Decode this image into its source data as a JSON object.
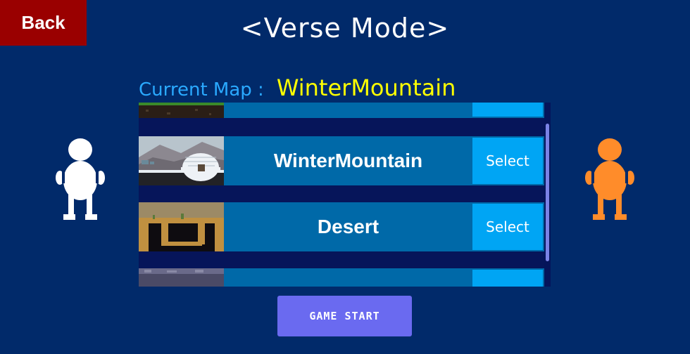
{
  "header": {
    "back_label": "Back",
    "title": "<Verse Mode>"
  },
  "current_map": {
    "label": "Current Map :",
    "value": "WinterMountain"
  },
  "map_list": {
    "items": [
      {
        "name": "",
        "select_label": "",
        "thumb": "grass-level"
      },
      {
        "name": "WinterMountain",
        "select_label": "Select",
        "thumb": "igloo-level"
      },
      {
        "name": "Desert",
        "select_label": "Select",
        "thumb": "desert-level"
      },
      {
        "name": "",
        "select_label": "",
        "thumb": "cave-level"
      }
    ]
  },
  "footer": {
    "start_label": "GAME START"
  },
  "players": [
    {
      "id": "player-1",
      "color": "#ffffff"
    },
    {
      "id": "player-2",
      "color": "#ff8c2a"
    }
  ],
  "colors": {
    "background": "#012a6a",
    "back_button": "#9a0000",
    "current_label": "#2aa9ff",
    "current_value": "#ffff00",
    "row": "#0069a8",
    "select_button": "#00a5f4",
    "start_button": "#6a6af0"
  }
}
